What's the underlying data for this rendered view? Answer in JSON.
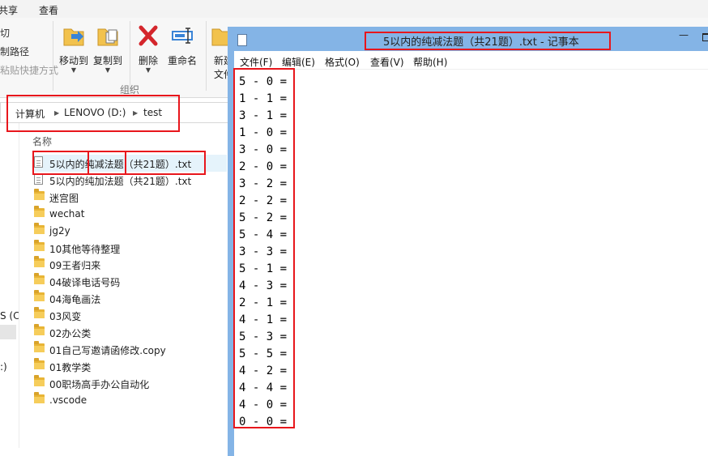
{
  "explorer": {
    "tabs": [
      {
        "label": "共享"
      },
      {
        "label": "查看"
      }
    ],
    "ribbon": {
      "clipboard_fragments": [
        "切",
        "制路径",
        "粘贴快捷方式"
      ],
      "buttons": [
        {
          "label": "移动到",
          "icon": "move-to-icon"
        },
        {
          "label": "复制到",
          "icon": "copy-to-icon"
        },
        {
          "label": "删除",
          "icon": "delete-icon"
        },
        {
          "label": "重命名",
          "icon": "rename-icon"
        },
        {
          "label": "新建",
          "label_line2": "文件",
          "icon": "new-folder-icon"
        }
      ],
      "group_label": "组织"
    },
    "address": {
      "items": [
        "计算机",
        "LENOVO (D:)",
        "test"
      ]
    },
    "left_nav": {
      "fragments": [
        "S (C",
        ":)"
      ]
    },
    "column_header": "名称",
    "files": [
      {
        "name": "5以内的纯减法题（共21题）.txt",
        "type": "txt",
        "selected": true
      },
      {
        "name": "5以内的纯加法题（共21题）.txt",
        "type": "txt",
        "selected": false
      },
      {
        "name": "迷宫图",
        "type": "folder",
        "selected": false
      },
      {
        "name": "wechat",
        "type": "folder",
        "selected": false
      },
      {
        "name": "jg2y",
        "type": "folder",
        "selected": false
      },
      {
        "name": "10其他等待整理",
        "type": "folder",
        "selected": false
      },
      {
        "name": "09王者归来",
        "type": "folder",
        "selected": false
      },
      {
        "name": "04破译电话号码",
        "type": "folder",
        "selected": false
      },
      {
        "name": "04海龟画法",
        "type": "folder",
        "selected": false
      },
      {
        "name": "03风变",
        "type": "folder",
        "selected": false
      },
      {
        "name": "02办公类",
        "type": "folder",
        "selected": false
      },
      {
        "name": "01自己写邀请函修改.copy",
        "type": "folder",
        "selected": false
      },
      {
        "name": "01教学类",
        "type": "folder",
        "selected": false
      },
      {
        "name": "00职场高手办公自动化",
        "type": "folder",
        "selected": false
      },
      {
        "name": ".vscode",
        "type": "folder",
        "selected": false
      }
    ]
  },
  "notepad": {
    "title": "5以内的纯减法题（共21题）.txt - 记事本",
    "menu": [
      {
        "label": "文件(F)"
      },
      {
        "label": "编辑(E)"
      },
      {
        "label": "格式(O)"
      },
      {
        "label": "查看(V)"
      },
      {
        "label": "帮助(H)"
      }
    ],
    "lines": [
      "5 - 0 =",
      "1 - 1 =",
      "3 - 1 =",
      "1 - 0 =",
      "3 - 0 =",
      "2 - 0 =",
      "3 - 2 =",
      "2 - 2 =",
      "5 - 2 =",
      "5 - 4 =",
      "3 - 3 =",
      "5 - 1 =",
      "4 - 3 =",
      "2 - 1 =",
      "4 - 1 =",
      "5 - 3 =",
      "5 - 5 =",
      "4 - 2 =",
      "4 - 4 =",
      "4 - 0 =",
      "0 - 0 ="
    ]
  },
  "colors": {
    "annotation_red": "#e8161c",
    "window_frame": "#84b4e6",
    "selection": "#e5f3fb",
    "folder": "#f6cd5b"
  }
}
